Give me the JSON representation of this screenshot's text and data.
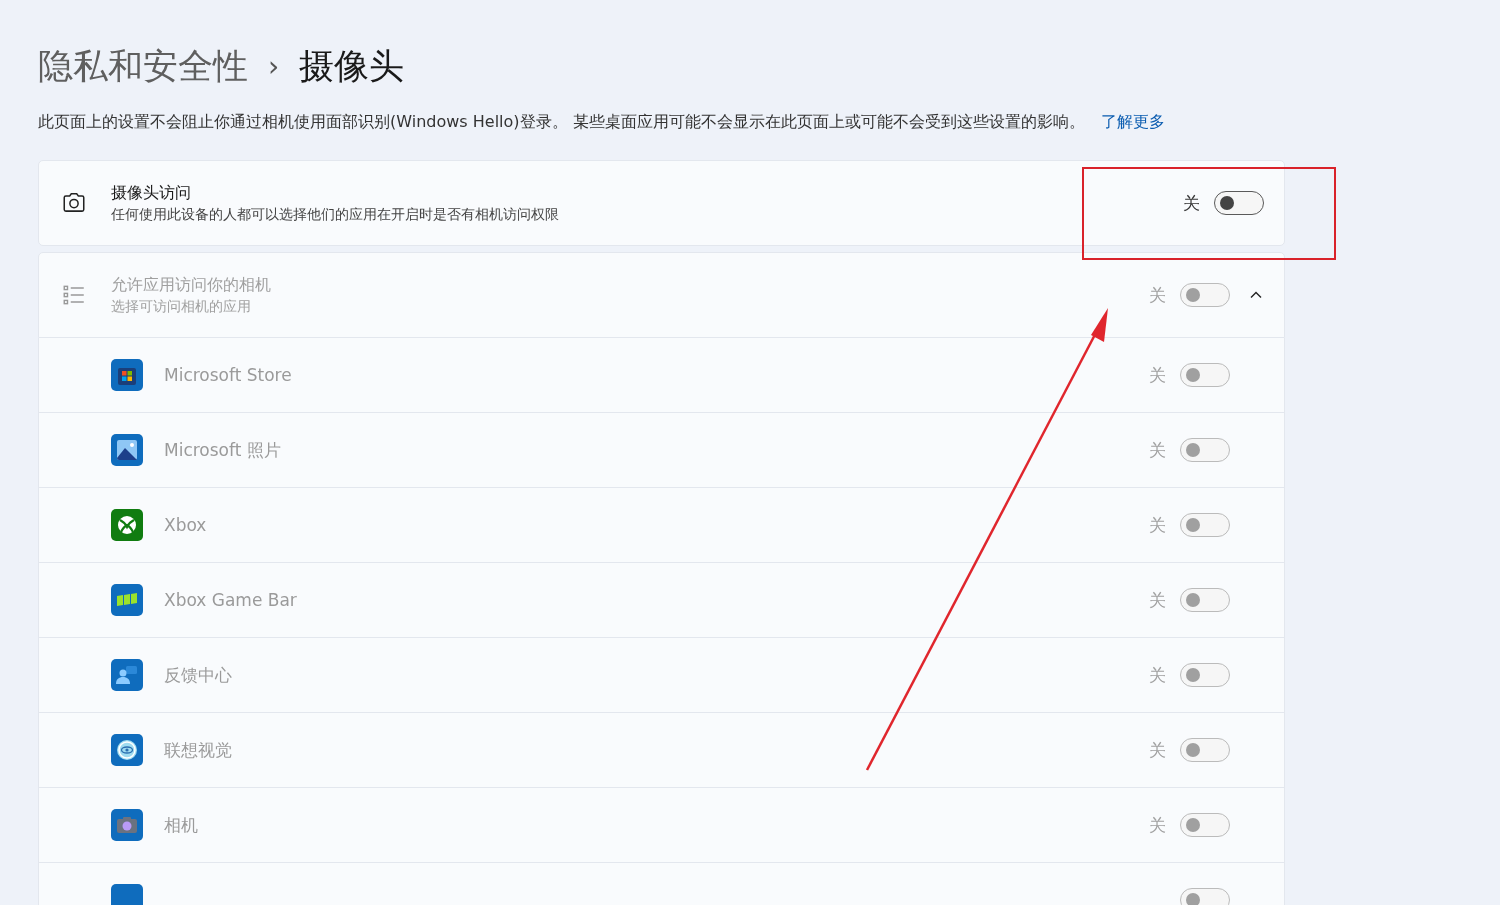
{
  "breadcrumb": {
    "parent": "隐私和安全性",
    "separator": "›",
    "current": "摄像头"
  },
  "description": {
    "text": "此页面上的设置不会阻止你通过相机使用面部识别(Windows Hello)登录。 某些桌面应用可能不会显示在此页面上或可能不会受到这些设置的影响。",
    "link": "了解更多"
  },
  "camera_access": {
    "title": "摄像头访问",
    "subtitle": "任何使用此设备的人都可以选择他们的应用在开启时是否有相机访问权限",
    "state_label": "关",
    "on": false,
    "disabled": false
  },
  "app_access": {
    "title": "允许应用访问你的相机",
    "subtitle": "选择可访问相机的应用",
    "state_label": "关",
    "on": false,
    "disabled": true,
    "expanded": true,
    "apps": [
      {
        "kind": "store",
        "name": "Microsoft Store",
        "state_label": "关",
        "on": false,
        "disabled": true
      },
      {
        "kind": "photos",
        "name": "Microsoft 照片",
        "state_label": "关",
        "on": false,
        "disabled": true
      },
      {
        "kind": "xbox",
        "name": "Xbox",
        "state_label": "关",
        "on": false,
        "disabled": true
      },
      {
        "kind": "gamebar",
        "name": "Xbox Game Bar",
        "state_label": "关",
        "on": false,
        "disabled": true
      },
      {
        "kind": "feedback",
        "name": "反馈中心",
        "state_label": "关",
        "on": false,
        "disabled": true
      },
      {
        "kind": "lens",
        "name": "联想视觉",
        "state_label": "关",
        "on": false,
        "disabled": true
      },
      {
        "kind": "camera",
        "name": "相机",
        "state_label": "关",
        "on": false,
        "disabled": true
      },
      {
        "kind": "generic",
        "on": false,
        "disabled": true
      }
    ]
  }
}
